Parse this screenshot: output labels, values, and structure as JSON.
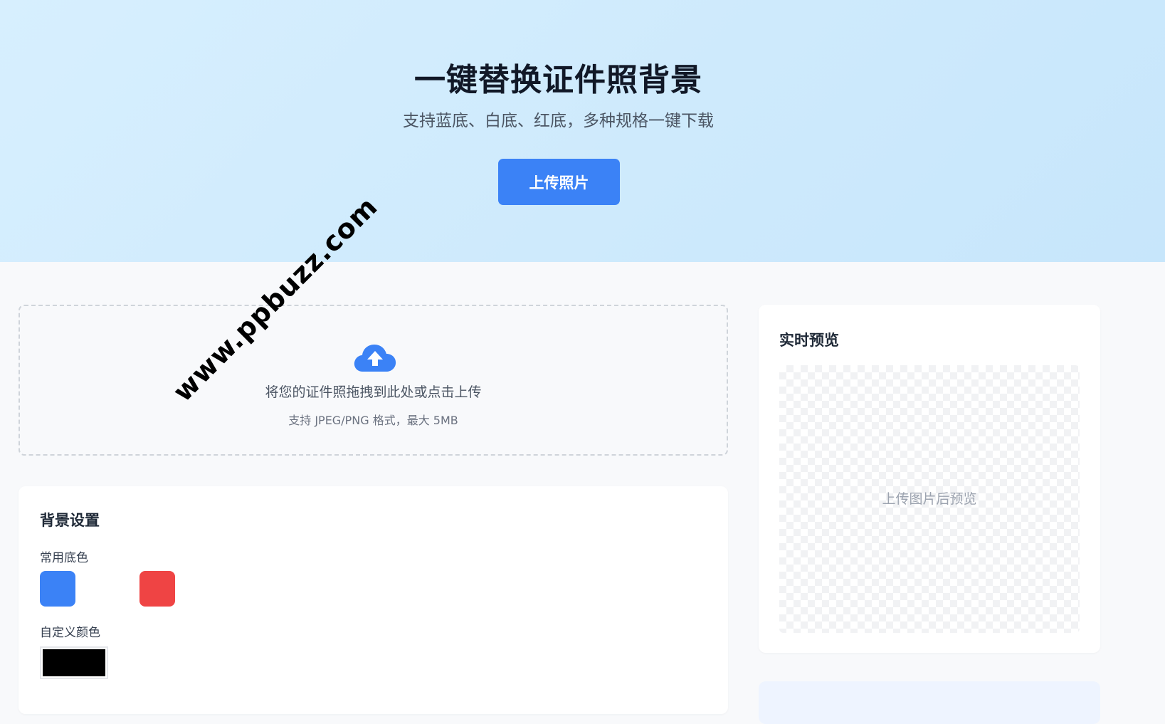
{
  "hero": {
    "title": "一键替换证件照背景",
    "subtitle": "支持蓝底、白底、红底，多种规格一键下载",
    "upload_button": "上传照片"
  },
  "dropzone": {
    "icon": "cloud-upload-icon",
    "text": "将您的证件照拖拽到此处或点击上传",
    "hint": "支持 JPEG/PNG 格式，最大 5MB"
  },
  "background_settings": {
    "title": "背景设置",
    "common_label": "常用底色",
    "swatches": [
      {
        "name": "blue",
        "color": "#3b82f6"
      },
      {
        "name": "white",
        "color": "#ffffff"
      },
      {
        "name": "red",
        "color": "#ef4444"
      }
    ],
    "custom_label": "自定义颜色",
    "custom_color": "#000000"
  },
  "preview": {
    "title": "实时预览",
    "placeholder": "上传图片后预览"
  },
  "watermark": "www.ppbuzz.com",
  "colors": {
    "accent": "#3b82f6",
    "hero_bg": "#d7effe"
  }
}
